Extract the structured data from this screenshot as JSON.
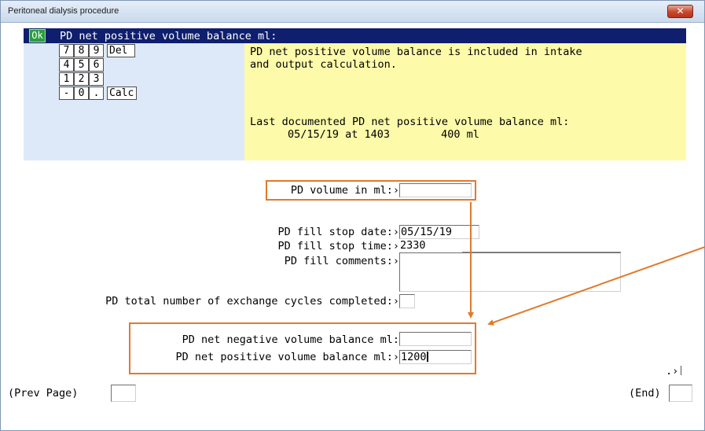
{
  "window": {
    "title": "Peritoneal dialysis procedure",
    "close_symbol": "✕"
  },
  "header": {
    "ok_label": "Ok",
    "title": "PD net positive volume balance ml:"
  },
  "keypad": {
    "rows": [
      [
        "7",
        "8",
        "9",
        "Del"
      ],
      [
        "4",
        "5",
        "6"
      ],
      [
        "1",
        "2",
        "3"
      ],
      [
        "-",
        "0",
        ".",
        "Calc"
      ]
    ]
  },
  "help": {
    "line1": "PD net positive volume balance is included in intake",
    "line2": "and output calculation.",
    "last_label": "Last documented PD net positive volume balance ml:",
    "last_value": "05/15/19 at 1403        400 ml"
  },
  "form": {
    "pd_volume_label": "PD volume in ml:",
    "pd_volume_value": "",
    "fill_stop_date_label": "PD fill stop date:",
    "fill_stop_date_value": "05/15/19",
    "fill_stop_time_label": "PD fill stop time:",
    "fill_stop_time_value": "2330",
    "fill_comments_label": "PD fill comments:",
    "fill_comments_value": "",
    "exchange_cycles_label": "PD total number of exchange cycles completed:",
    "exchange_cycles_value": "",
    "neg_balance_label": "PD net negative volume balance ml:",
    "neg_balance_value": "",
    "pos_balance_label": "PD net positive volume balance ml:",
    "pos_balance_value": "1200",
    "arrow_marker": "›"
  },
  "footer": {
    "prev_page_label": "(Prev Page)",
    "end_label": "(End)",
    "small_marker": ".›"
  },
  "colors": {
    "header_bg": "#0f1f6e",
    "keypad_bg": "#dde9f8",
    "help_bg": "#fdfbaa",
    "annotation": "#e07a2c",
    "ok_green": "#2a9d3f"
  }
}
